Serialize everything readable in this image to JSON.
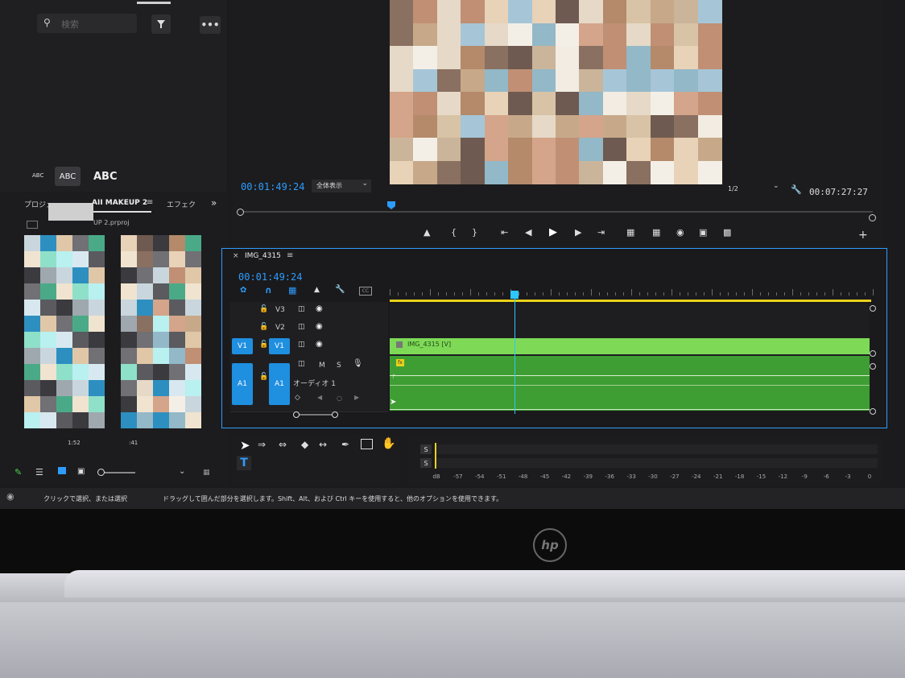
{
  "search": {
    "placeholder": "検索"
  },
  "text_styles": [
    "ABC",
    "ABC",
    "ABC"
  ],
  "project_panel": {
    "tab_project": "プロジェ",
    "tab_bin": "AII MAKEUP 2",
    "tab_effects": "エフェク",
    "file_name": "UP 2.prproj",
    "thumb_time_1": "1:52",
    "thumb_time_2": ":41"
  },
  "program_monitor": {
    "timecode": "00:01:49:24",
    "zoom": "全体表示",
    "resolution": "1/2",
    "duration": "00:07:27:27"
  },
  "timeline": {
    "sequence_name": "IMG_4315",
    "timecode": "00:01:49:24",
    "tracks": {
      "v3": "V3",
      "v2": "V2",
      "v1_src": "V1",
      "v1": "V1",
      "a1_src": "A1",
      "a1": "A1",
      "m": "M",
      "s": "S",
      "audio_name": "オーディオ 1"
    },
    "clip_label": "IMG_4315 [V]",
    "fx_badge": "fx"
  },
  "audio_meter": {
    "solo_labels": [
      "S",
      "S"
    ],
    "scale": [
      "dB",
      "-57",
      "-54",
      "-51",
      "-48",
      "-45",
      "-42",
      "-39",
      "-36",
      "-33",
      "-30",
      "-27",
      "-24",
      "-21",
      "-18",
      "-15",
      "-12",
      "-9",
      "-6",
      "-3",
      "0"
    ]
  },
  "status_bar": {
    "hint_1": "クリックで選択、または選択",
    "hint_2": "ドラッグして囲んだ部分を選択します。Shift、Alt、および Ctrl キーを使用すると、他のオプションを使用できます。"
  },
  "brand": {
    "logo": "hp"
  },
  "colors": {
    "accent_blue": "#2d9cff",
    "clip_green": "#7ed957",
    "audio_green": "#3f9e33",
    "playhead": "#2dc6ff",
    "work_area": "#e8d21a"
  }
}
